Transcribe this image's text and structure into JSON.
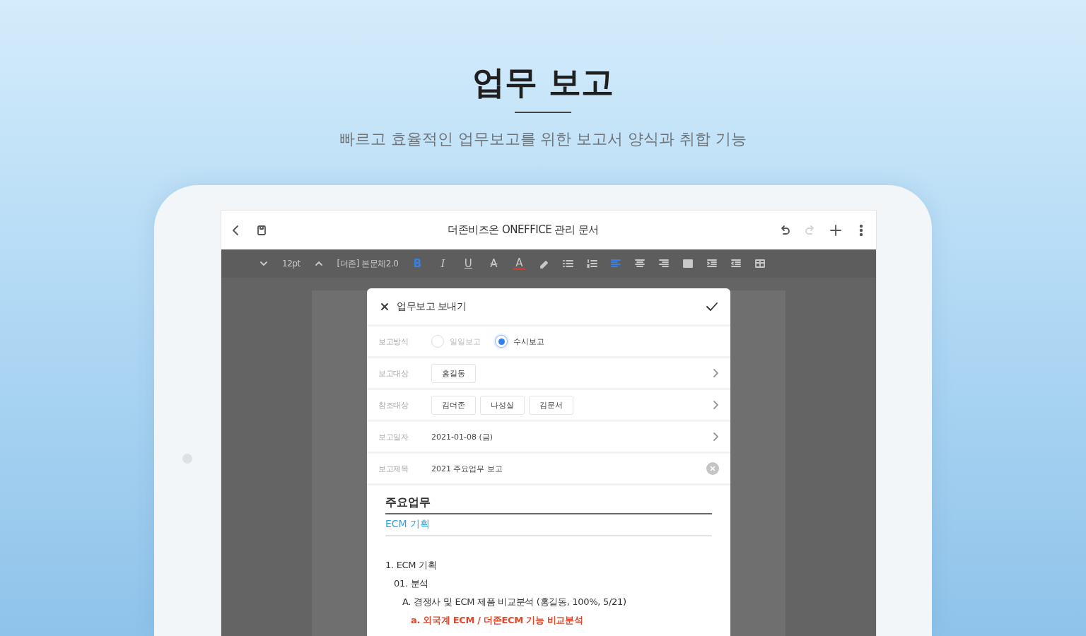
{
  "promo": {
    "title": "업무 보고",
    "subtitle": "빠르고 효율적인 업무보고를 위한 보고서 양식과 취합 기능"
  },
  "app_bar": {
    "title": "더존비즈온 ONEFFICE 관리 문서",
    "actions": [
      {
        "disabled": false
      },
      {
        "disabled": true
      },
      {
        "disabled": false
      },
      {
        "disabled": false
      }
    ]
  },
  "toolbar": [
    {
      "kind": "decrease"
    },
    {
      "kind": "text",
      "text": "12pt"
    },
    {
      "kind": "increase"
    },
    {
      "kind": "text",
      "text": "[더존] 본문체2.0"
    },
    {
      "kind": "bold",
      "text": "B",
      "selected": true
    },
    {
      "kind": "italic",
      "text": "I",
      "selected": false
    },
    {
      "kind": "underline",
      "text": "U",
      "selected": false
    },
    {
      "kind": "strike",
      "text": "A",
      "selected": false
    },
    {
      "kind": "color",
      "text": "A",
      "selected": false
    },
    {
      "kind": "highlighter",
      "selected": false
    },
    {
      "kind": "bullets",
      "selected": false
    },
    {
      "kind": "numbers",
      "selected": false
    },
    {
      "kind": "left",
      "selected": true
    },
    {
      "kind": "center",
      "selected": false
    },
    {
      "kind": "right",
      "selected": false
    },
    {
      "kind": "justify",
      "selected": false
    },
    {
      "kind": "indent",
      "selected": false
    },
    {
      "kind": "outdent",
      "selected": false
    },
    {
      "kind": "table",
      "selected": false
    }
  ],
  "dialog": {
    "title": "업무보고 보내기",
    "fields": [
      {
        "kind": "radio",
        "label": "보고방식",
        "options": [
          {
            "label": "일일보고",
            "selected": false
          },
          {
            "label": "수시보고",
            "selected": true
          }
        ]
      },
      {
        "kind": "chips",
        "label": "보고대상",
        "chips": [
          "홍길동"
        ]
      },
      {
        "kind": "chips",
        "label": "참조대상",
        "chips": [
          "김더존",
          "나성실",
          "김문서"
        ]
      },
      {
        "kind": "link",
        "label": "보고일자",
        "value": "2021-01-08 (금)"
      },
      {
        "kind": "input",
        "label": "보고제목",
        "value": "2021 주요업무 보고"
      }
    ],
    "section": {
      "heading": "주요업무",
      "subheading": "ECM 기획"
    },
    "outline": [
      {
        "text": "1. ECM 기획",
        "emphasis": false,
        "children": [
          {
            "text": "01. 분석",
            "emphasis": false,
            "children": [
              {
                "text": "A. 경쟁사 및 ECM 제품 비교분석 (홍길동, 100%, 5/21)",
                "emphasis": false,
                "children": [
                  {
                    "text": "a. 외국계 ECM / 더존ECM 기능 비교분석",
                    "emphasis": true
                  }
                ]
              }
            ]
          }
        ]
      }
    ]
  }
}
